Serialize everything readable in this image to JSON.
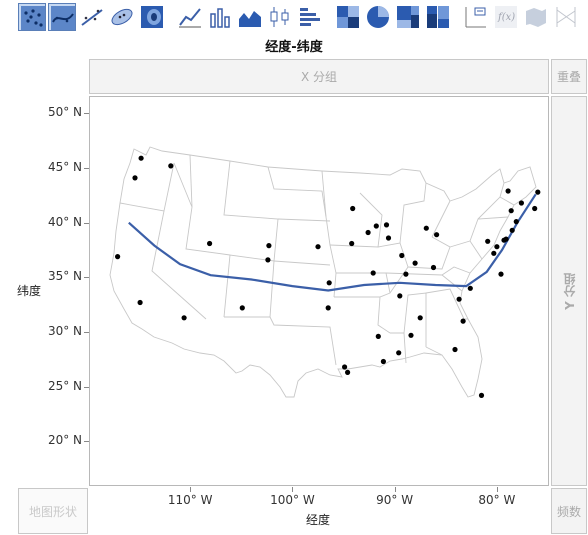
{
  "toolbar": {
    "items": [
      {
        "name": "points-element",
        "selected": true
      },
      {
        "name": "smoother-element",
        "selected": true
      },
      {
        "name": "line-of-fit-element",
        "selected": false
      },
      {
        "name": "ellipse-element",
        "selected": false
      },
      {
        "name": "contour-element",
        "selected": false
      },
      {
        "name": "line-element",
        "selected": false
      },
      {
        "name": "bar-element",
        "selected": false
      },
      {
        "name": "area-element",
        "selected": false
      },
      {
        "name": "box-plot-element",
        "selected": false
      },
      {
        "name": "histogram-element",
        "selected": false
      },
      {
        "name": "heatmap-element",
        "selected": false
      },
      {
        "name": "pie-element",
        "selected": false
      },
      {
        "name": "treemap-element",
        "selected": false
      },
      {
        "name": "mosaic-element",
        "selected": false
      },
      {
        "name": "caption-box-element",
        "selected": false
      },
      {
        "name": "formula-element",
        "selected": false
      },
      {
        "name": "map-shapes-element",
        "selected": false
      },
      {
        "name": "parallel-element",
        "selected": false
      }
    ]
  },
  "graph": {
    "title": "经度-纬度",
    "x_group_label": "X 分组",
    "y_group_label": "Y 分组",
    "overlay_label": "重叠",
    "map_shape_label": "地图形状",
    "freq_label": "频数",
    "x_axis_title": "经度",
    "y_axis_title": "纬度"
  },
  "chart_data": {
    "type": "scatter",
    "xlabel": "经度",
    "ylabel": "纬度",
    "xlim": [
      -119.8,
      -75.0
    ],
    "ylim": [
      16.0,
      51.5
    ],
    "x_ticks": [
      {
        "value": -110,
        "label": "110° W"
      },
      {
        "value": -100,
        "label": "100° W"
      },
      {
        "value": -90,
        "label": "90° W"
      },
      {
        "value": -80,
        "label": "80° W"
      }
    ],
    "y_ticks": [
      {
        "value": 50,
        "label": "50° N"
      },
      {
        "value": 45,
        "label": "45° N"
      },
      {
        "value": 40,
        "label": "40° N"
      },
      {
        "value": 35,
        "label": "35° N"
      },
      {
        "value": 30,
        "label": "30° N"
      },
      {
        "value": 25,
        "label": "25° N"
      },
      {
        "value": 20,
        "label": "20° N"
      }
    ],
    "points": [
      {
        "x": -114.8,
        "y": 45.9
      },
      {
        "x": -115.4,
        "y": 44.1
      },
      {
        "x": -111.9,
        "y": 45.2
      },
      {
        "x": -117.1,
        "y": 36.9
      },
      {
        "x": -114.9,
        "y": 32.7
      },
      {
        "x": -110.6,
        "y": 31.3
      },
      {
        "x": -108.1,
        "y": 38.1
      },
      {
        "x": -104.9,
        "y": 32.2
      },
      {
        "x": -102.3,
        "y": 37.9
      },
      {
        "x": -102.4,
        "y": 36.6
      },
      {
        "x": -97.5,
        "y": 37.8
      },
      {
        "x": -96.4,
        "y": 34.5
      },
      {
        "x": -96.5,
        "y": 32.2
      },
      {
        "x": -94.9,
        "y": 26.8
      },
      {
        "x": -94.6,
        "y": 26.3
      },
      {
        "x": -94.1,
        "y": 41.3
      },
      {
        "x": -94.2,
        "y": 38.1
      },
      {
        "x": -92.6,
        "y": 39.1
      },
      {
        "x": -91.8,
        "y": 39.7
      },
      {
        "x": -90.8,
        "y": 39.8
      },
      {
        "x": -90.6,
        "y": 38.6
      },
      {
        "x": -92.1,
        "y": 35.4
      },
      {
        "x": -91.6,
        "y": 29.6
      },
      {
        "x": -91.1,
        "y": 27.3
      },
      {
        "x": -89.5,
        "y": 33.3
      },
      {
        "x": -89.6,
        "y": 28.1
      },
      {
        "x": -88.4,
        "y": 29.7
      },
      {
        "x": -89.3,
        "y": 37.0
      },
      {
        "x": -88.9,
        "y": 35.3
      },
      {
        "x": -88.0,
        "y": 36.3
      },
      {
        "x": -86.9,
        "y": 39.5
      },
      {
        "x": -85.9,
        "y": 38.9
      },
      {
        "x": -87.5,
        "y": 31.3
      },
      {
        "x": -86.2,
        "y": 35.9
      },
      {
        "x": -83.7,
        "y": 33.0
      },
      {
        "x": -82.6,
        "y": 34.0
      },
      {
        "x": -83.3,
        "y": 31.0
      },
      {
        "x": -84.1,
        "y": 28.4
      },
      {
        "x": -81.5,
        "y": 24.2
      },
      {
        "x": -80.9,
        "y": 38.3
      },
      {
        "x": -80.3,
        "y": 37.2
      },
      {
        "x": -80.0,
        "y": 37.8
      },
      {
        "x": -79.3,
        "y": 38.4
      },
      {
        "x": -79.1,
        "y": 38.5
      },
      {
        "x": -79.6,
        "y": 35.3
      },
      {
        "x": -78.5,
        "y": 39.3
      },
      {
        "x": -78.1,
        "y": 40.1
      },
      {
        "x": -78.9,
        "y": 42.9
      },
      {
        "x": -78.6,
        "y": 41.1
      },
      {
        "x": -77.6,
        "y": 41.8
      },
      {
        "x": -76.3,
        "y": 41.3
      },
      {
        "x": -76.0,
        "y": 42.8
      }
    ],
    "smoother": [
      {
        "x": -116.0,
        "y": 40.0
      },
      {
        "x": -113.5,
        "y": 37.9
      },
      {
        "x": -111.0,
        "y": 36.2
      },
      {
        "x": -108.0,
        "y": 35.2
      },
      {
        "x": -104.0,
        "y": 34.8
      },
      {
        "x": -100.0,
        "y": 34.2
      },
      {
        "x": -96.5,
        "y": 33.8
      },
      {
        "x": -93.0,
        "y": 34.3
      },
      {
        "x": -89.5,
        "y": 34.5
      },
      {
        "x": -86.0,
        "y": 34.3
      },
      {
        "x": -83.0,
        "y": 34.2
      },
      {
        "x": -81.0,
        "y": 35.5
      },
      {
        "x": -79.5,
        "y": 37.5
      },
      {
        "x": -78.0,
        "y": 40.0
      },
      {
        "x": -76.2,
        "y": 42.6
      }
    ],
    "colors": {
      "points": "#000000",
      "smoother": "#3b5fa8",
      "map_boundaries": "#c8c8c8"
    }
  }
}
